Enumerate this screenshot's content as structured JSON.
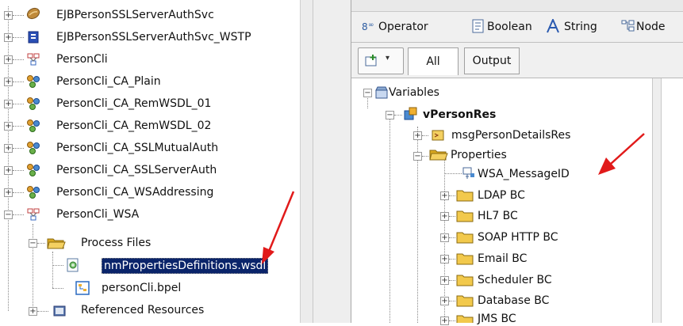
{
  "left_tree": {
    "items": [
      {
        "label": "EJBPersonSSLServerAuthSvc",
        "icon": "ejb-bean-icon",
        "expander": "+"
      },
      {
        "label": "EJBPersonSSLServerAuthSvc_WSTP",
        "icon": "wstp-module-icon",
        "expander": "+"
      },
      {
        "label": "PersonCli",
        "icon": "bpel-project-icon",
        "expander": "+"
      },
      {
        "label": "PersonCli_CA_Plain",
        "icon": "composite-app-icon",
        "expander": "+"
      },
      {
        "label": "PersonCli_CA_RemWSDL_01",
        "icon": "composite-app-icon",
        "expander": "+"
      },
      {
        "label": "PersonCli_CA_RemWSDL_02",
        "icon": "composite-app-icon",
        "expander": "+"
      },
      {
        "label": "PersonCli_CA_SSLMutualAuth",
        "icon": "composite-app-icon",
        "expander": "+"
      },
      {
        "label": "PersonCli_CA_SSLServerAuth",
        "icon": "composite-app-icon",
        "expander": "+"
      },
      {
        "label": "PersonCli_CA_WSAddressing",
        "icon": "composite-app-icon",
        "expander": "+"
      },
      {
        "label": "PersonCli_WSA",
        "icon": "bpel-project-icon",
        "expander": "−"
      }
    ],
    "process_files": "Process Files",
    "wsdl_file": "nmPropertiesDefinitions.wsdl",
    "bpel_file": "personCli.bpel",
    "referenced_resources": "Referenced Resources"
  },
  "toolbar": {
    "operator": "Operator",
    "boolean": "Boolean",
    "string": "String",
    "nodes": "Node"
  },
  "tabs": {
    "all": "All",
    "output": "Output"
  },
  "right_tree": {
    "variables": "Variables",
    "vperson": "vPersonRes",
    "msg": "msgPersonDetailsRes",
    "properties": "Properties",
    "wsa": "WSA_MessageID",
    "folders": [
      "LDAP BC",
      "HL7 BC",
      "SOAP HTTP BC",
      "Email BC",
      "Scheduler BC",
      "Database BC",
      "JMS BC"
    ]
  },
  "colors": {
    "selection_bg": "#0a246a",
    "arrow_red": "#e11a1a",
    "folder_yellow": "#f2c94c"
  }
}
